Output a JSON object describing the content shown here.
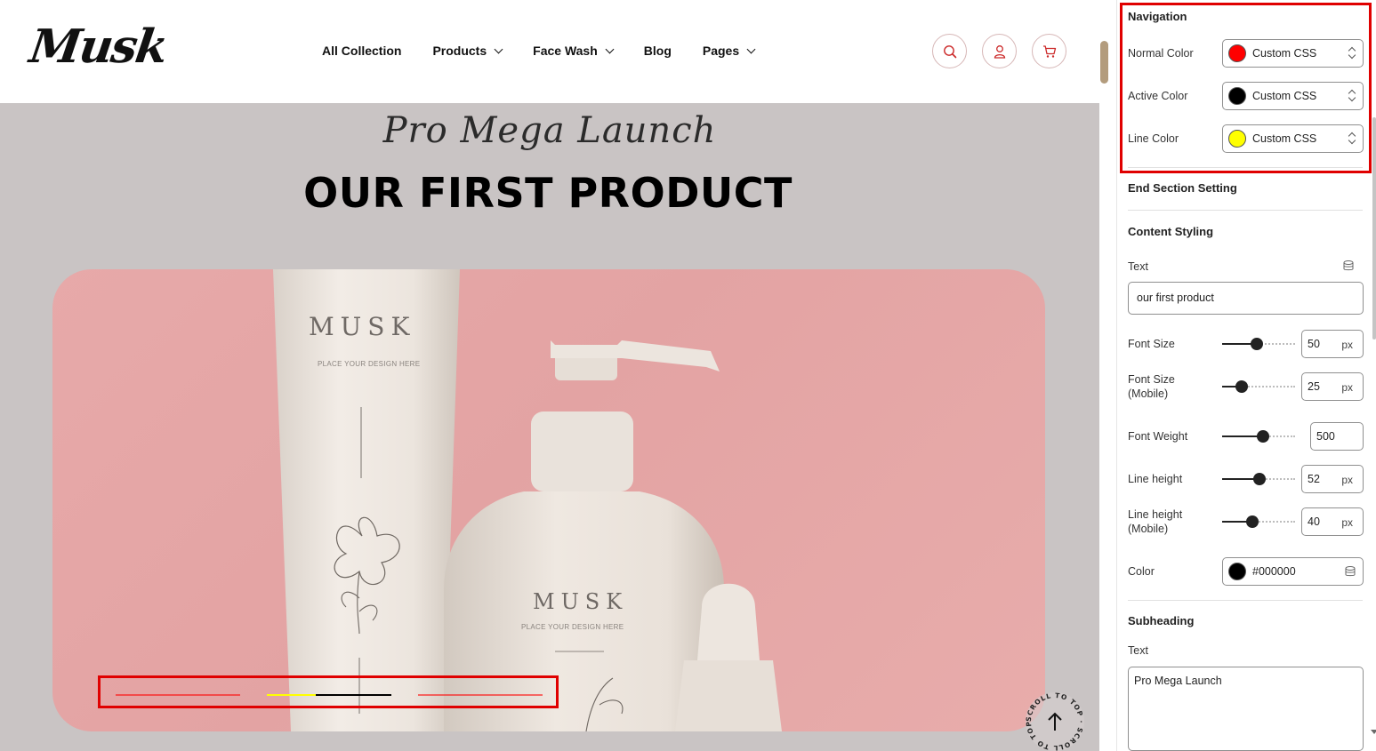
{
  "header": {
    "logo": "Musk",
    "nav": [
      {
        "label": "All Collection",
        "dropdown": false
      },
      {
        "label": "Products",
        "dropdown": true
      },
      {
        "label": "Face Wash",
        "dropdown": true
      },
      {
        "label": "Blog",
        "dropdown": false
      },
      {
        "label": "Pages",
        "dropdown": true
      }
    ],
    "icons": [
      "search-icon",
      "user-icon",
      "cart-icon"
    ]
  },
  "hero": {
    "subheading": "Pro Mega Launch",
    "heading": "OUR FIRST PRODUCT",
    "tube_brand": "MUSK",
    "tube_caption": "PLACE YOUR DESIGN HERE",
    "bottle_brand": "MUSK",
    "bottle_caption": "PLACE YOUR DESIGN HERE",
    "card_color": "#e5a6a6",
    "slider_indicator": {
      "segment_count": 3,
      "active_segment": 2,
      "active_progress": 0.39,
      "colors": {
        "normal": "#ff0000",
        "active": "#000000",
        "line": "#ffff00"
      }
    },
    "scroll_top_text": "SCROLL TO TOP · SCROLL TO TOP ·"
  },
  "settings": {
    "navigation": {
      "title": "Navigation",
      "normal": {
        "label": "Normal Color",
        "value": "Custom CSS",
        "swatch": "#ff0000"
      },
      "active": {
        "label": "Active Color",
        "value": "Custom CSS",
        "swatch": "#000000"
      },
      "line": {
        "label": "Line Color",
        "value": "Custom CSS",
        "swatch": "#ffff00"
      }
    },
    "end_section_title": "End Section Setting",
    "content_styling": {
      "title": "Content Styling",
      "text_label": "Text",
      "text_value": "our first product",
      "font_size": {
        "label": "Font Size",
        "value": "50",
        "unit": "px",
        "level": 0.48
      },
      "font_size_mobile": {
        "label1": "Font Size",
        "label2": "(Mobile)",
        "value": "25",
        "unit": "px",
        "level": 0.27
      },
      "font_weight": {
        "label": "Font Weight",
        "value": "500",
        "level": 0.56
      },
      "line_height": {
        "label": "Line height",
        "value": "52",
        "unit": "px",
        "level": 0.51
      },
      "line_height_mobile": {
        "label1": "Line height",
        "label2": "(Mobile)",
        "value": "40",
        "unit": "px",
        "level": 0.42
      },
      "color": {
        "label": "Color",
        "value": "#000000",
        "swatch": "#000000"
      }
    },
    "subheading": {
      "title": "Subheading",
      "text_label": "Text",
      "text_value": "Pro Mega Launch"
    }
  }
}
